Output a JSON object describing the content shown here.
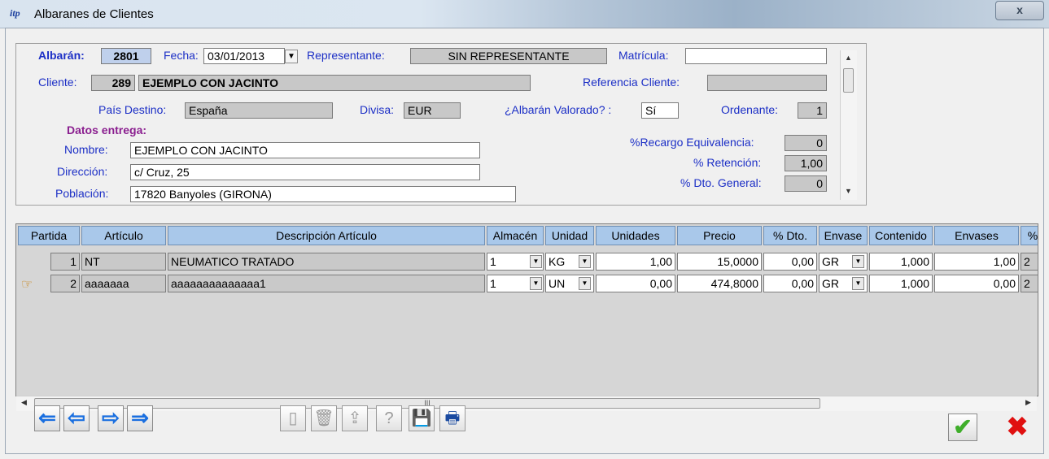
{
  "window": {
    "title": "Albaranes de Clientes",
    "icon": "itp-logo-icon",
    "close": "x"
  },
  "header": {
    "albaran_label": "Albarán:",
    "albaran_value": "2801",
    "fecha_label": "Fecha:",
    "fecha_value": "03/01/2013",
    "representante_label": "Representante:",
    "representante_value": "SIN REPRESENTANTE",
    "matricula_label": "Matrícula:",
    "matricula_value": "",
    "cliente_label": "Cliente:",
    "cliente_code": "289",
    "cliente_name": "EJEMPLO CON JACINTO",
    "referencia_label": "Referencia Cliente:",
    "referencia_value": "",
    "pais_label": "País Destino:",
    "pais_value": "España",
    "divisa_label": "Divisa:",
    "divisa_value": "EUR",
    "valorado_label": "¿Albarán Valorado? :",
    "valorado_value": "Sí",
    "ordenante_label": "Ordenante:",
    "ordenante_value": "1",
    "datos_entrega_label": "Datos entrega:",
    "nombre_label": "Nombre:",
    "nombre_value": "EJEMPLO CON JACINTO",
    "direccion_label": "Dirección:",
    "direccion_value": "c/ Cruz, 25",
    "poblacion_label": "Población:",
    "poblacion_value": "17820 Banyoles (GIRONA)",
    "recargo_label": "%Recargo Equivalencia:",
    "recargo_value": "0",
    "retencion_label": "% Retención:",
    "retencion_value": "1,00",
    "dto_general_label": "% Dto. General:",
    "dto_general_value": "0"
  },
  "grid": {
    "columns": [
      "Partida",
      "Artículo",
      "Descripción Artículo",
      "Almacén",
      "Unidad",
      "Unidades",
      "Precio",
      "% Dto.",
      "Envase",
      "Contenido",
      "Envases",
      "%"
    ],
    "rows": [
      {
        "partida": "1",
        "articulo": "NT",
        "descripcion": "NEUMATICO TRATADO",
        "almacen": "1",
        "unidad": "KG",
        "unidades": "1,00",
        "precio": "15,0000",
        "dto": "0,00",
        "envase": "GR",
        "contenido": "1,000",
        "envases": "1,00",
        "pct": "2",
        "current": false
      },
      {
        "partida": "2",
        "articulo": "aaaaaaa",
        "descripcion": "aaaaaaaaaaaaaa1",
        "almacen": "1",
        "unidad": "UN",
        "unidades": "0,00",
        "precio": "474,8000",
        "dto": "0,00",
        "envase": "GR",
        "contenido": "1,000",
        "envases": "0,00",
        "pct": "2",
        "current": true
      }
    ],
    "hscroll_mark": "III"
  },
  "toolbar": {
    "nav": [
      "first-record-icon",
      "previous-record-icon",
      "next-record-icon",
      "last-record-icon"
    ],
    "tools": [
      "new-document-icon",
      "delete-icon",
      "upload-icon",
      "help-icon",
      "save-icon",
      "print-icon"
    ]
  },
  "colors": {
    "label_blue": "#1c2fc6",
    "section_purple": "#8a1e8f",
    "header_blue": "#a9c8ea"
  }
}
